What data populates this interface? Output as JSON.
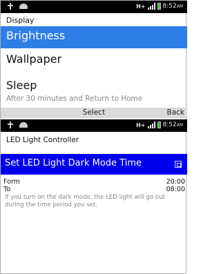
{
  "top_screen": {
    "status": {
      "network": "H+",
      "time": "8:52",
      "ampm": "AM"
    },
    "title": "Display",
    "items": [
      {
        "label": "Brightness"
      },
      {
        "label": "Wallpaper"
      },
      {
        "label": "Sleep"
      }
    ],
    "sleep_detail": "After 30 minutes and Return to Home",
    "softkeys": {
      "center": "Select",
      "right": "Back"
    }
  },
  "bottom_screen": {
    "status": {
      "network": "H+",
      "time": "8:52",
      "ampm": "AM"
    },
    "title": "LED Light Controller",
    "option_label": "Set LED Light Dark Mode Time",
    "option_checked": false,
    "from_label": "Form",
    "from_value": "20:00",
    "to_label": "To",
    "to_value": "08:00",
    "note": "If you turn on the dark mode, the LED light will go out during the time period you set."
  },
  "colors": {
    "selection_blue": "#2f7ee8",
    "option_blue": "#0000ee",
    "status_bar": "#000000",
    "battery": "#3fc13f"
  }
}
